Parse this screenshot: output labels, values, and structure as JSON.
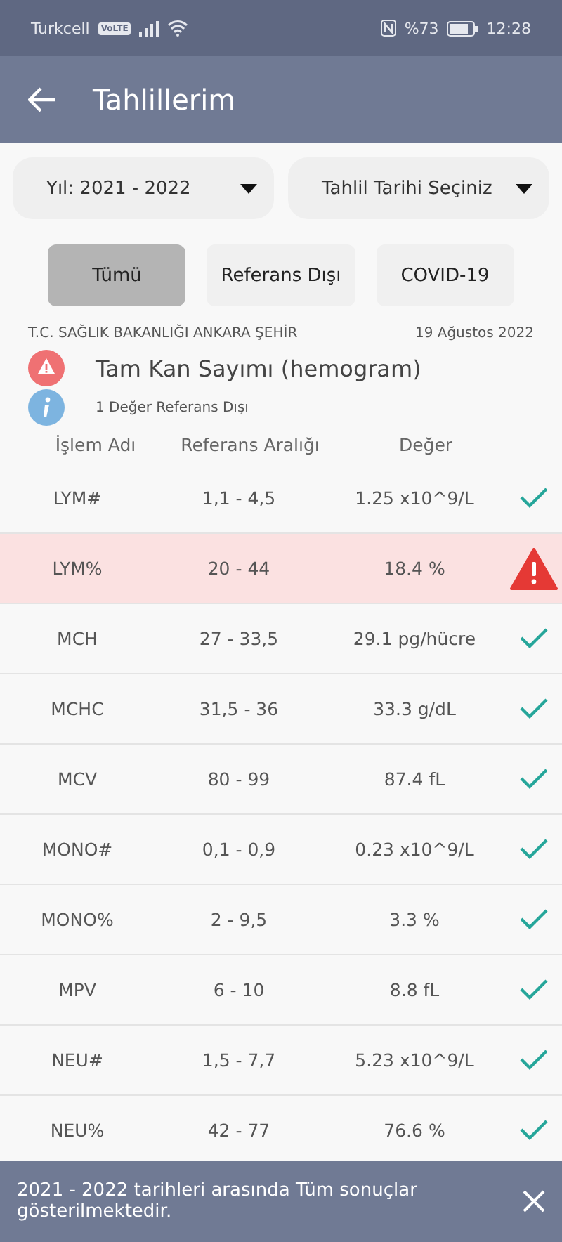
{
  "status_bar": {
    "carrier": "Turkcell",
    "volte": "VoLTE",
    "battery": "%73",
    "time": "12:28"
  },
  "app_bar": {
    "title": "Tahlillerim"
  },
  "dropdowns": [
    {
      "value": "Yıl: 2021 - 2022"
    },
    {
      "value": "Tahlil Tarihi Seçiniz"
    }
  ],
  "filters": [
    {
      "label": "Tümü",
      "selected": true
    },
    {
      "label": "Referans Dışı",
      "selected": false
    },
    {
      "label": "COVID-19",
      "selected": false
    }
  ],
  "report": {
    "institution": "T.C. SAĞLIK BAKANLIĞI ANKARA ŞEHİR",
    "date": "19 Ağustos 2022",
    "test_name": "Tam Kan Sayımı (hemogram)",
    "summary": "1 Değer Referans Dışı"
  },
  "table": {
    "columns": [
      "İşlem Adı",
      "Referans Aralığı",
      "Değer"
    ],
    "rows": [
      {
        "name": "LYM#",
        "range": "1,1 - 4,5",
        "value": "1.25 x10^9/L",
        "out_of_range": false
      },
      {
        "name": "LYM%",
        "range": "20 - 44",
        "value": "18.4 %",
        "out_of_range": true
      },
      {
        "name": "MCH",
        "range": "27 - 33,5",
        "value": "29.1 pg/hücre",
        "out_of_range": false
      },
      {
        "name": "MCHC",
        "range": "31,5 - 36",
        "value": "33.3 g/dL",
        "out_of_range": false
      },
      {
        "name": "MCV",
        "range": "80 - 99",
        "value": "87.4 fL",
        "out_of_range": false
      },
      {
        "name": "MONO#",
        "range": "0,1 - 0,9",
        "value": "0.23 x10^9/L",
        "out_of_range": false
      },
      {
        "name": "MONO%",
        "range": "2 - 9,5",
        "value": "3.3 %",
        "out_of_range": false
      },
      {
        "name": "MPV",
        "range": "6 - 10",
        "value": "8.8 fL",
        "out_of_range": false
      },
      {
        "name": "NEU#",
        "range": "1,5 - 7,7",
        "value": "5.23 x10^9/L",
        "out_of_range": false
      },
      {
        "name": "NEU%",
        "range": "42 - 77",
        "value": "76.6 %",
        "out_of_range": false
      }
    ]
  },
  "snackbar": {
    "message": "2021 - 2022 tarihleri arasında Tüm sonuçlar gösterilmektedir."
  }
}
